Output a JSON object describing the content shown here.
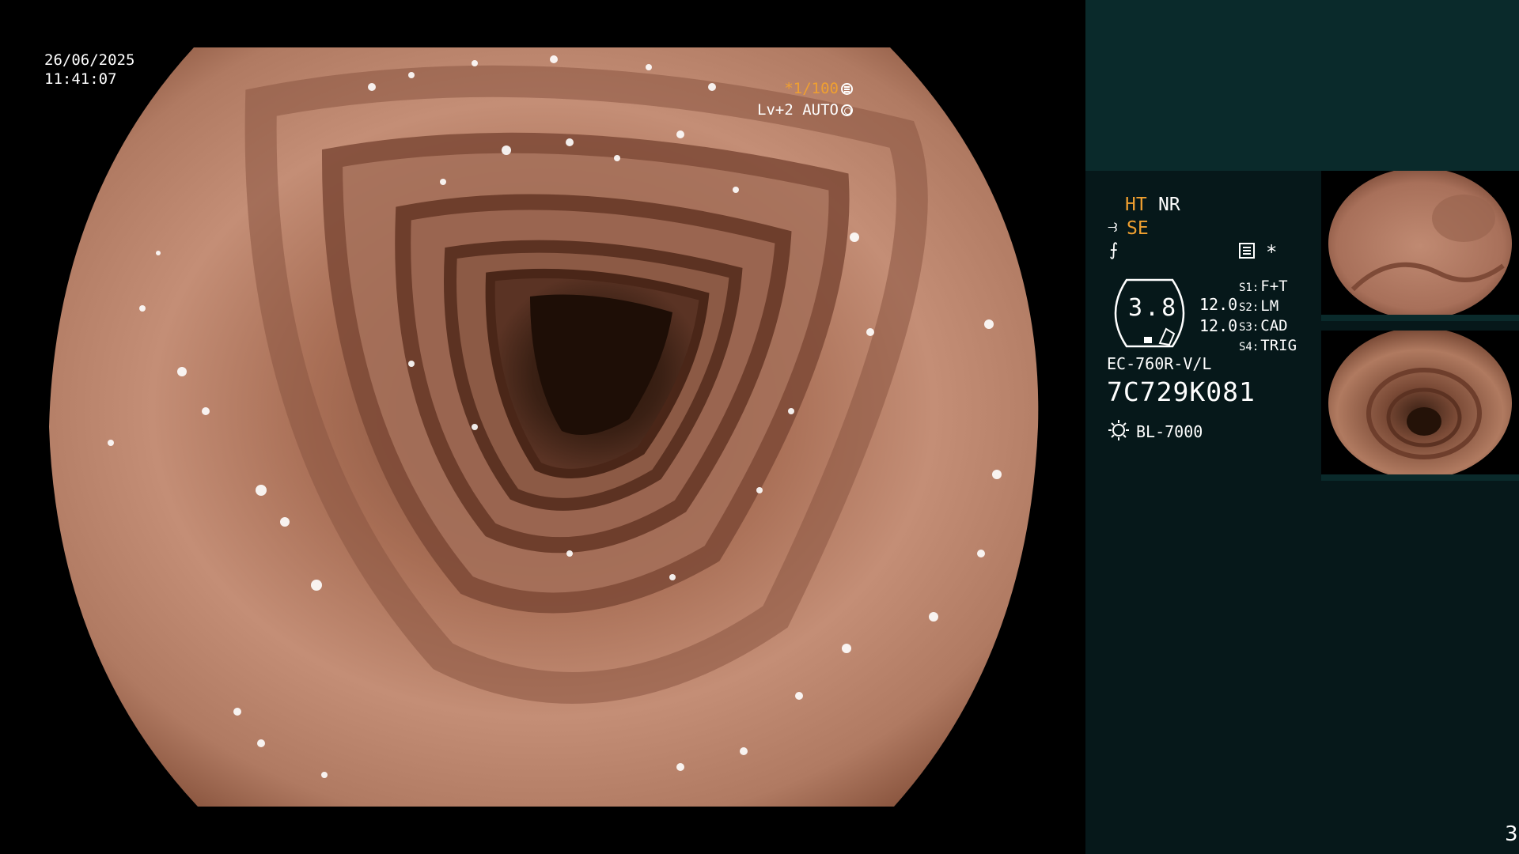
{
  "osd": {
    "date": "26/06/2025",
    "time": "11:41:07",
    "shutter_speed": "*1/100",
    "level_mode": "Lv+2 AUTO",
    "shutter_icon": "shutter-icon",
    "auto_icon": "auto-iris-icon"
  },
  "panel": {
    "ht": "HT",
    "nr": "NR",
    "se": "SE",
    "star": "*",
    "gauge_value": "3.8",
    "value_top": "12.0",
    "value_bottom": "12.0",
    "switches": [
      {
        "label": "S1:",
        "value": "F+T"
      },
      {
        "label": "S2:",
        "value": "LM"
      },
      {
        "label": "S3:",
        "value": "CAD"
      },
      {
        "label": "S4:",
        "value": "TRIG"
      }
    ],
    "scope_model": "EC-760R-V/L",
    "scope_serial": "7C729K081",
    "light_source": "BL-7000"
  },
  "page_number": "3",
  "colors": {
    "accent": "#f0a030",
    "panel_bg": "#06181a",
    "panel_top": "#0a2a2b"
  }
}
